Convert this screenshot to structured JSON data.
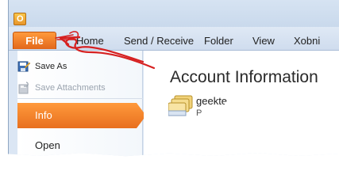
{
  "app": {
    "icon_glyph": "O"
  },
  "ribbon": {
    "file_tab": "File",
    "tabs": [
      "Home",
      "Send / Receive",
      "Folder",
      "View",
      "Xobni"
    ]
  },
  "backstage": {
    "commands": [
      {
        "label": "Save As",
        "icon": "save-as-icon",
        "enabled": true
      },
      {
        "label": "Save Attachments",
        "icon": "save-attachments-icon",
        "enabled": false
      }
    ],
    "info_label": "Info",
    "open_label": "Open"
  },
  "main": {
    "heading": "Account Information",
    "account": {
      "name": "geekte",
      "sub": "P"
    }
  },
  "colors": {
    "accent_orange": "#e86f1e",
    "annotation_red": "#d62020",
    "ribbon_blue": "#cfdcee"
  }
}
